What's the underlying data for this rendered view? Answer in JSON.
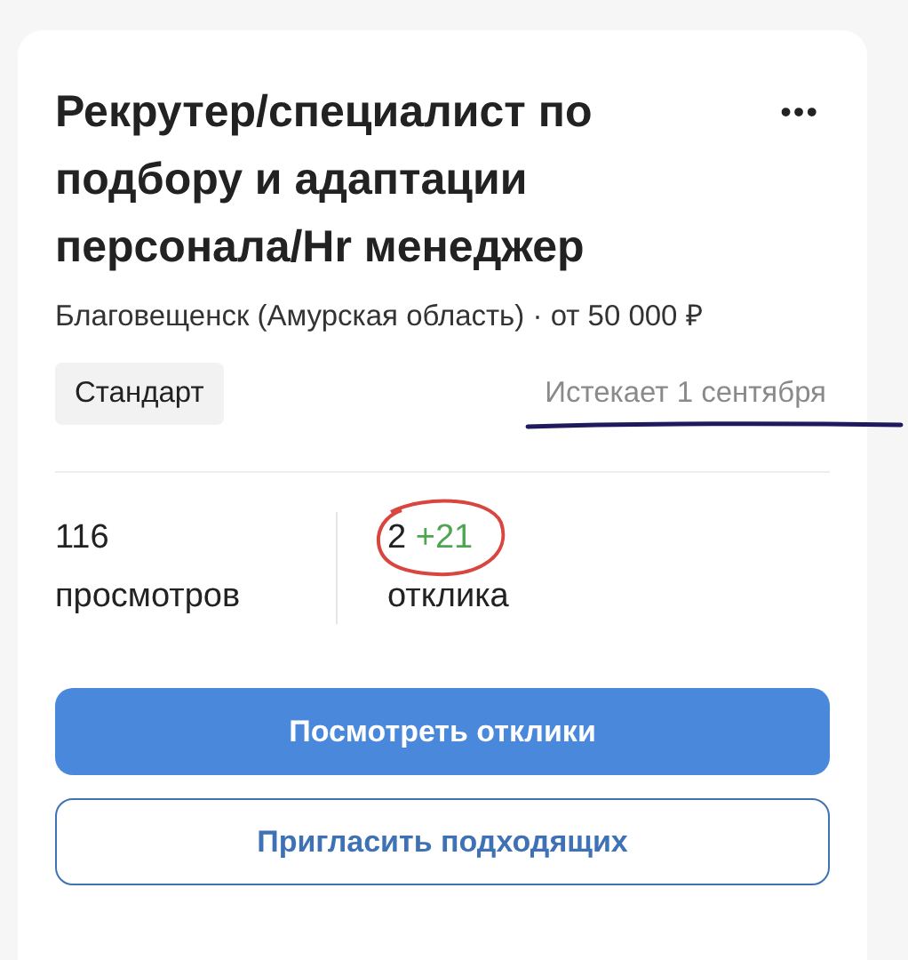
{
  "vacancy": {
    "title": "Рекрутер/специалист по подбору и адаптации персонала/Hr менеджер",
    "menu": "•••",
    "location": "Благовещенск (Амурская область) · от 50 000 ₽",
    "tariff": "Стандарт",
    "expires": "Истекает 1 сентября"
  },
  "stats": [
    {
      "kind": "plain",
      "value": "116",
      "label": "просмотров"
    },
    {
      "kind": "delta",
      "value": "2",
      "delta": "+21",
      "label": "отклика"
    }
  ],
  "buttons": [
    {
      "kind": "primary",
      "label": "Посмотреть отклики"
    },
    {
      "kind": "outline",
      "label": "Пригласить подходящих"
    }
  ]
}
